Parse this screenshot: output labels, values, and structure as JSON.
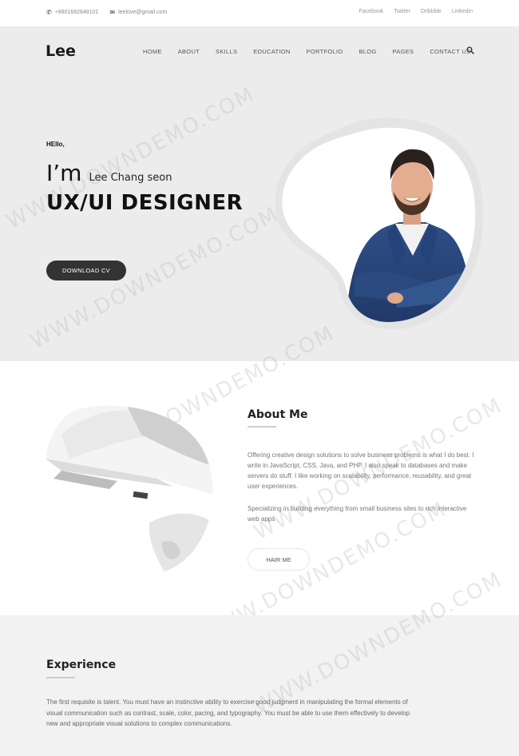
{
  "topbar": {
    "phone": "+8801682648101",
    "email": "leelove@gmail.com",
    "social": [
      "Facebook",
      "Twitter",
      "Dribbble",
      "Linkedin"
    ]
  },
  "header": {
    "logo": "Lee",
    "nav": [
      "HOME",
      "ABOUT",
      "SKILLS",
      "EDUCATION",
      "PORTFOLIO",
      "BLOG",
      "PAGES",
      "CONTACT US"
    ]
  },
  "hero": {
    "greeting": "HEllo,",
    "im": "I’m",
    "name": "Lee Chang seon",
    "role": "UX/UI DESIGNER",
    "cta": "DOWNLOAD CV"
  },
  "about": {
    "title": "About Me",
    "paragraph1": "Offering creative design solutions to solve business problems is what I do best. I write in JavaScript, CSS, Java, and PHP. I also speak to databases and make servers do stuff. I like working on scalability, performance, reusability, and great user experiences.",
    "paragraph2": "Specializing in building everything from small business sites to rich interactive web apps",
    "cta": "HAIR ME"
  },
  "experience": {
    "title": "Experience",
    "text": "The first requisite is talent. You must have an instinctive ability to exercise good judgment in manipulating the formal elements of visual communication such as contrast, scale, color, pacing, and typography. You must be able to use them effectively to develop new and appropriate visual solutions to complex communications."
  },
  "watermark": "WWW.DOWNDEMO.COM",
  "icons": {
    "phone": "phone-icon",
    "email": "envelope-icon",
    "search": "search-icon"
  }
}
